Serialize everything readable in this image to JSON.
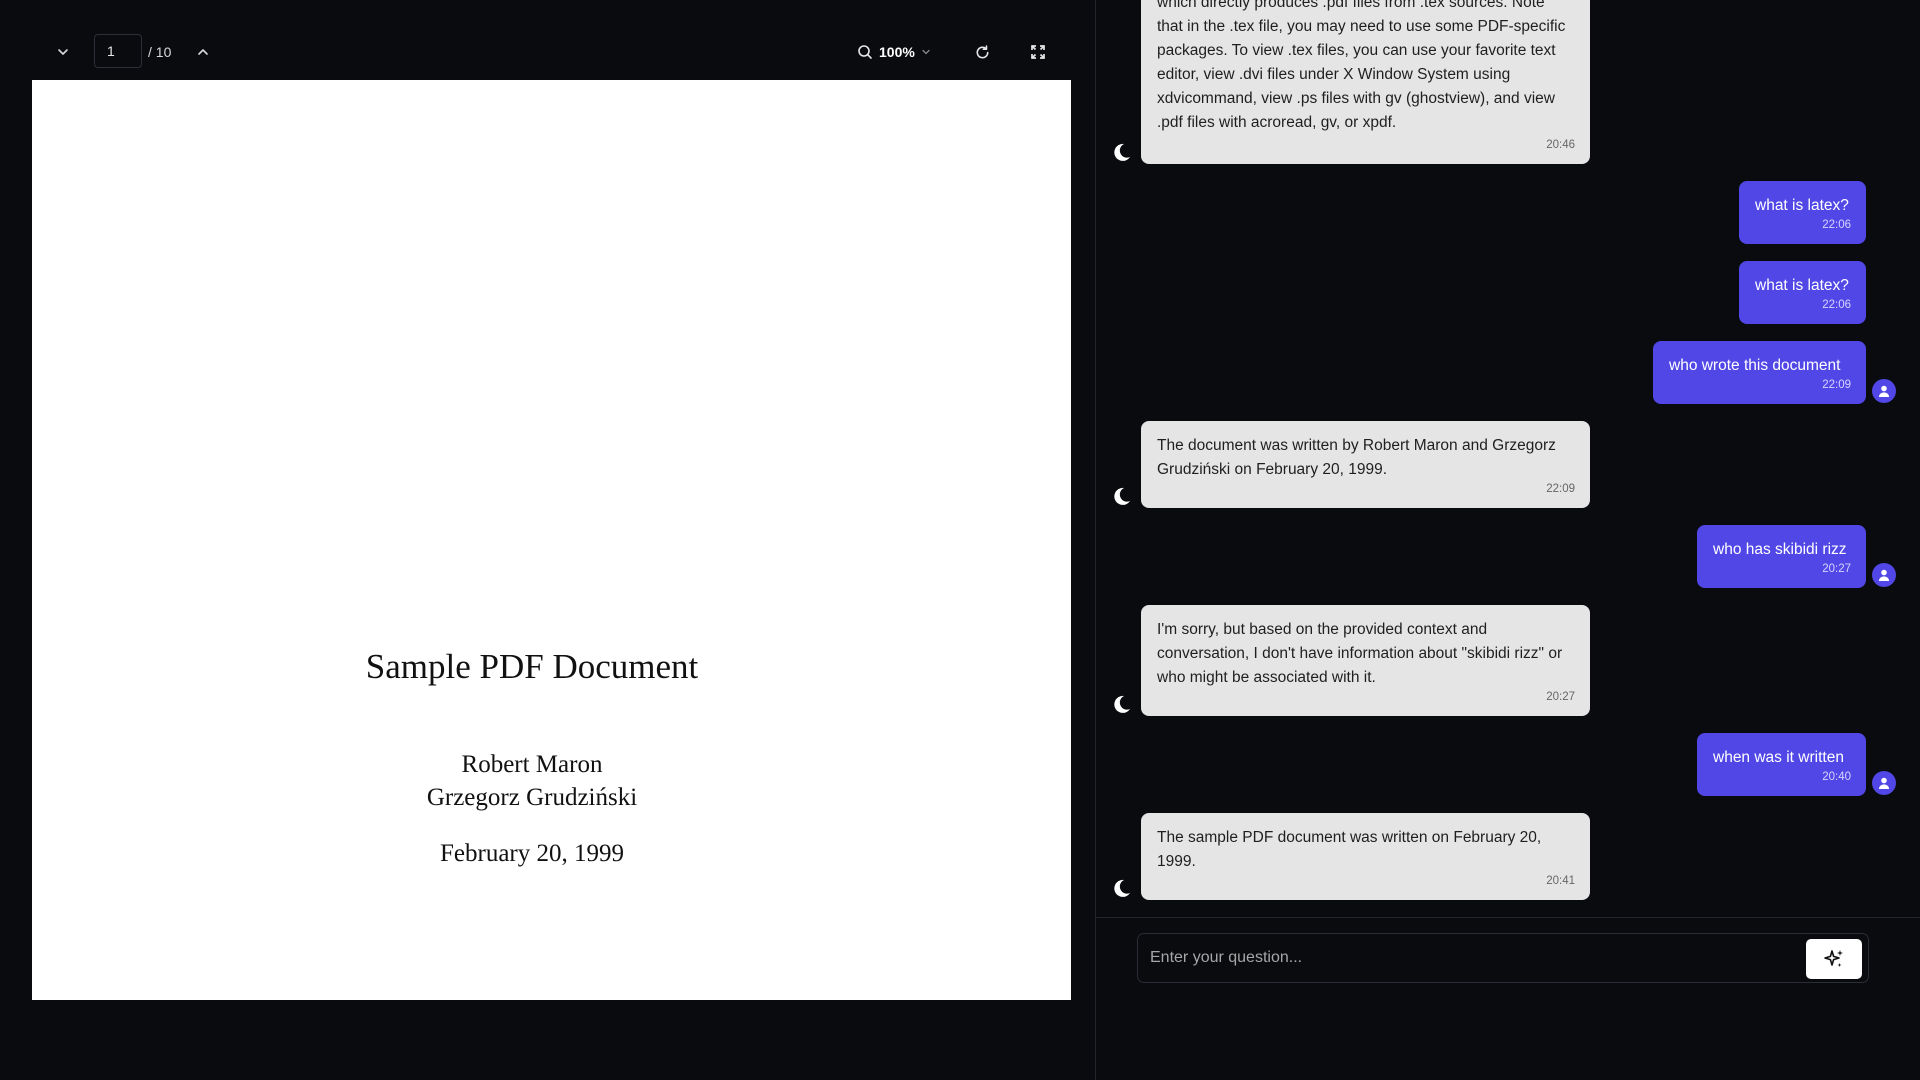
{
  "viewer": {
    "page_current": "1",
    "page_total": "/ 10",
    "zoom": "100%",
    "document": {
      "title": "Sample PDF Document",
      "authors": [
        "Robert Maron",
        "Grzegorz Grudziński"
      ],
      "date": "February 20, 1999"
    }
  },
  "chat": {
    "messages": [
      {
        "role": "bot",
        "text": "which directly produces .pdf files from .tex sources. Note that in the .tex file, you may need to use some PDF-specific packages. To view .tex files, you can use your favorite text editor, view .dvi files under X Window System using xdvicommand, view .ps files with gv (ghostview), and view .pdf files with acroread, gv, or xpdf.",
        "time": "20:46"
      },
      {
        "role": "user",
        "text": "what is latex?",
        "time": "22:06"
      },
      {
        "role": "user",
        "text": "what is latex?",
        "time": "22:06"
      },
      {
        "role": "user",
        "text": "who wrote this document",
        "time": "22:09"
      },
      {
        "role": "bot",
        "text": "The document was written by Robert Maron and Grzegorz Grudziński on February 20, 1999.",
        "time": "22:09"
      },
      {
        "role": "user",
        "text": "who has skibidi rizz",
        "time": "20:27"
      },
      {
        "role": "bot",
        "text": "I'm sorry, but based on the provided context and conversation, I don't have information about \"skibidi rizz\" or who might be associated with it.",
        "time": "20:27"
      },
      {
        "role": "user",
        "text": "when was it written",
        "time": "20:40"
      },
      {
        "role": "bot",
        "text": "The sample PDF document was written on February 20, 1999.",
        "time": "20:41"
      }
    ],
    "input": {
      "placeholder": "Enter your question...",
      "value": ""
    }
  },
  "colors": {
    "background": "#0a0b0f",
    "user_bubble": "#5147e6",
    "bot_bubble": "#e5e5e5",
    "page": "#ffffff"
  },
  "icons": [
    "chevron-down-icon",
    "chevron-up-icon",
    "search-icon",
    "refresh-icon",
    "fullscreen-icon",
    "moon-icon",
    "user-icon",
    "sparkle-icon"
  ]
}
